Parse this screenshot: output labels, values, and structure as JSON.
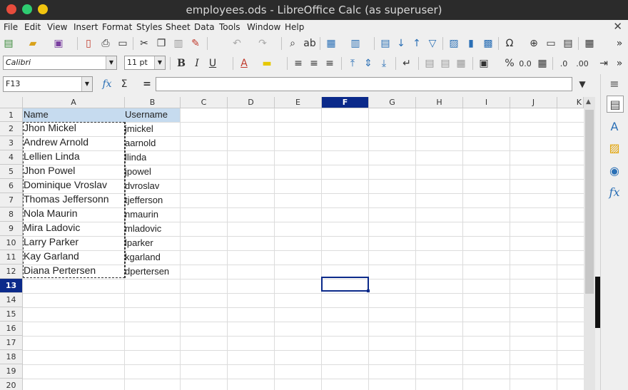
{
  "window": {
    "title": "employees.ods - LibreOffice Calc (as superuser)",
    "buttons": {
      "close": "#e74c3c",
      "minimize": "#2ecc71",
      "maximize": "#f1c40f"
    }
  },
  "menu": [
    "File",
    "Edit",
    "View",
    "Insert",
    "Format",
    "Styles",
    "Sheet",
    "Data",
    "Tools",
    "Window",
    "Help"
  ],
  "formatting": {
    "font_name": "Calibri",
    "font_size": "11 pt"
  },
  "formula": {
    "name_box": "F13",
    "content": ""
  },
  "columns": [
    "A",
    "B",
    "C",
    "D",
    "E",
    "F",
    "G",
    "H",
    "I",
    "J",
    "K"
  ],
  "active_column": "F",
  "rows": [
    "1",
    "2",
    "3",
    "4",
    "5",
    "6",
    "7",
    "8",
    "9",
    "10",
    "11",
    "12",
    "13",
    "14",
    "15",
    "16",
    "17",
    "18",
    "19",
    "20"
  ],
  "active_row": "13",
  "sheet": {
    "header": {
      "a": "Name",
      "b": "Username"
    },
    "records": [
      {
        "a": "Jhon Mickel",
        "b": "jmickel"
      },
      {
        "a": "Andrew Arnold",
        "b": "aarnold"
      },
      {
        "a": "Lellien Linda",
        "b": "llinda"
      },
      {
        "a": "Jhon Powel",
        "b": "jpowel"
      },
      {
        "a": "Dominique Vroslav",
        "b": "dvroslav"
      },
      {
        "a": "Thomas Jeffersonn",
        "b": "tjefferson"
      },
      {
        "a": "Nola Maurin",
        "b": "nmaurin"
      },
      {
        "a": "Mira Ladovic",
        "b": "mladovic"
      },
      {
        "a": "Larry Parker",
        "b": "lparker"
      },
      {
        "a": "Kay Garland",
        "b": "kgarland"
      },
      {
        "a": "Diana Pertersen",
        "b": "dpertersen"
      }
    ]
  },
  "icons": {
    "toolbar1": [
      "new-icon",
      "open-icon",
      "save-icon",
      "export-pdf-icon",
      "print-icon",
      "print-preview-icon",
      "cut-icon",
      "copy-icon",
      "paste-icon",
      "clone-formatting-icon",
      "undo-icon",
      "redo-icon",
      "find-replace-icon",
      "spelling-icon",
      "row-icon",
      "column-icon",
      "sort-icon",
      "sort-ascending-icon",
      "sort-descending-icon",
      "autofilter-icon",
      "image-icon",
      "chart-icon",
      "pivot-table-icon",
      "special-character-icon",
      "hyperlink-icon",
      "comment-icon",
      "headers-footers-icon",
      "define-print-area-icon"
    ],
    "sidebar": [
      "properties-icon",
      "styles-icon",
      "gallery-icon",
      "navigator-icon",
      "functions-icon"
    ]
  }
}
